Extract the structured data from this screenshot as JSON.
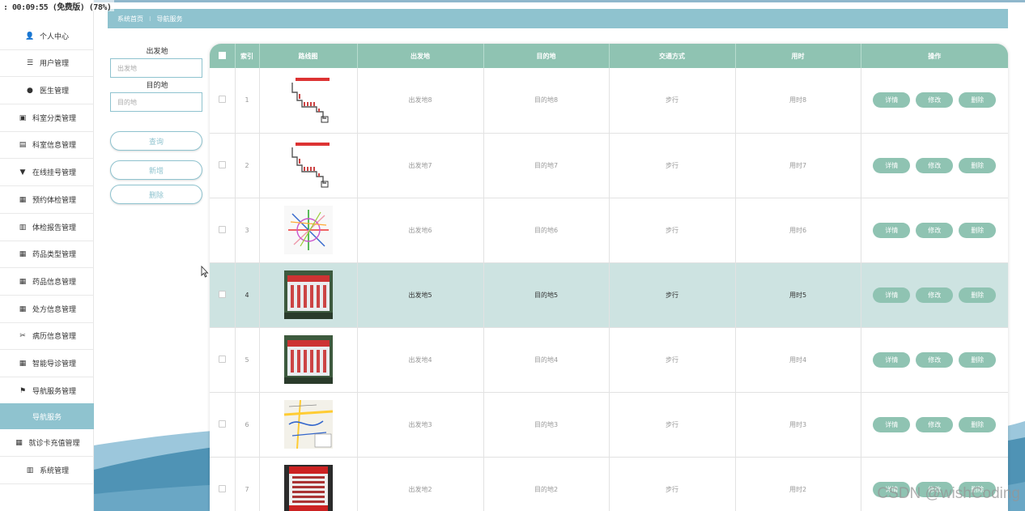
{
  "recording_banner": ": 00:09:55 (免费版) (78%)",
  "sidebar": {
    "items": [
      {
        "label": "个人中心",
        "icon": "user-icon",
        "glyph": "👤"
      },
      {
        "label": "用户管理",
        "icon": "list-icon",
        "glyph": "☰"
      },
      {
        "label": "医生管理",
        "icon": "pin-icon",
        "glyph": "●"
      },
      {
        "label": "科室分类管理",
        "icon": "clipboard-icon",
        "glyph": "▣"
      },
      {
        "label": "科室信息管理",
        "icon": "briefcase-icon",
        "glyph": "▤"
      },
      {
        "label": "在线挂号管理",
        "icon": "pushpin-icon",
        "glyph": "▼"
      },
      {
        "label": "预约体检管理",
        "icon": "grid-icon",
        "glyph": "▦"
      },
      {
        "label": "体检报告管理",
        "icon": "bar-chart-icon",
        "glyph": "▥"
      },
      {
        "label": "药品类型管理",
        "icon": "grid-icon",
        "glyph": "▦"
      },
      {
        "label": "药品信息管理",
        "icon": "grid-icon",
        "glyph": "▦"
      },
      {
        "label": "处方信息管理",
        "icon": "grid-icon",
        "glyph": "▦"
      },
      {
        "label": "病历信息管理",
        "icon": "ticket-icon",
        "glyph": "✂"
      },
      {
        "label": "智能导诊管理",
        "icon": "grid-icon",
        "glyph": "▦"
      },
      {
        "label": "导航服务管理",
        "icon": "flag-icon",
        "glyph": "⚑"
      },
      {
        "label": "导航服务",
        "icon": "",
        "glyph": ""
      },
      {
        "label": "就诊卡充值管理",
        "icon": "grid-icon",
        "glyph": "▦"
      },
      {
        "label": "系统管理",
        "icon": "bar-chart-icon",
        "glyph": "▥"
      }
    ]
  },
  "breadcrumb": {
    "home": "系统首页",
    "separator": "⁝",
    "current": "导航服务"
  },
  "search": {
    "origin_label": "出发地",
    "origin_placeholder": "出发地",
    "destination_label": "目的地",
    "destination_placeholder": "目的地",
    "query_button": "查询",
    "add_button": "新增",
    "delete_button": "删除"
  },
  "table": {
    "headers": [
      "索引",
      "路线图",
      "出发地",
      "目的地",
      "交通方式",
      "用时",
      "操作"
    ],
    "action_labels": {
      "detail": "详情",
      "edit": "修改",
      "delete": "删除"
    },
    "rows": [
      {
        "index": "1",
        "origin": "出发地8",
        "destination": "目的地8",
        "transport": "步行",
        "duration": "用时8",
        "thumb": "route-map-red",
        "highlighted": false
      },
      {
        "index": "2",
        "origin": "出发地7",
        "destination": "目的地7",
        "transport": "步行",
        "duration": "用时7",
        "thumb": "route-map-red",
        "highlighted": false
      },
      {
        "index": "3",
        "origin": "出发地6",
        "destination": "目的地6",
        "transport": "步行",
        "duration": "用时6",
        "thumb": "metro-map",
        "highlighted": false
      },
      {
        "index": "4",
        "origin": "出发地5",
        "destination": "目的地5",
        "transport": "步行",
        "duration": "用时5",
        "thumb": "bus-sign-photo",
        "highlighted": true
      },
      {
        "index": "5",
        "origin": "出发地4",
        "destination": "目的地4",
        "transport": "步行",
        "duration": "用时4",
        "thumb": "bus-sign-photo",
        "highlighted": false
      },
      {
        "index": "6",
        "origin": "出发地3",
        "destination": "目的地3",
        "transport": "步行",
        "duration": "用时3",
        "thumb": "street-map",
        "highlighted": false
      },
      {
        "index": "7",
        "origin": "出发地2",
        "destination": "目的地2",
        "transport": "步行",
        "duration": "用时2",
        "thumb": "bus-board-photo",
        "highlighted": false
      }
    ]
  },
  "watermark": "CSDN @wishCoding",
  "colors": {
    "accent": "#8fc3cf",
    "table_header": "#8fc3b2",
    "row_highlight": "#cde3e1",
    "wave_dark": "#4f93b5",
    "wave_light": "#9cc7dc"
  }
}
